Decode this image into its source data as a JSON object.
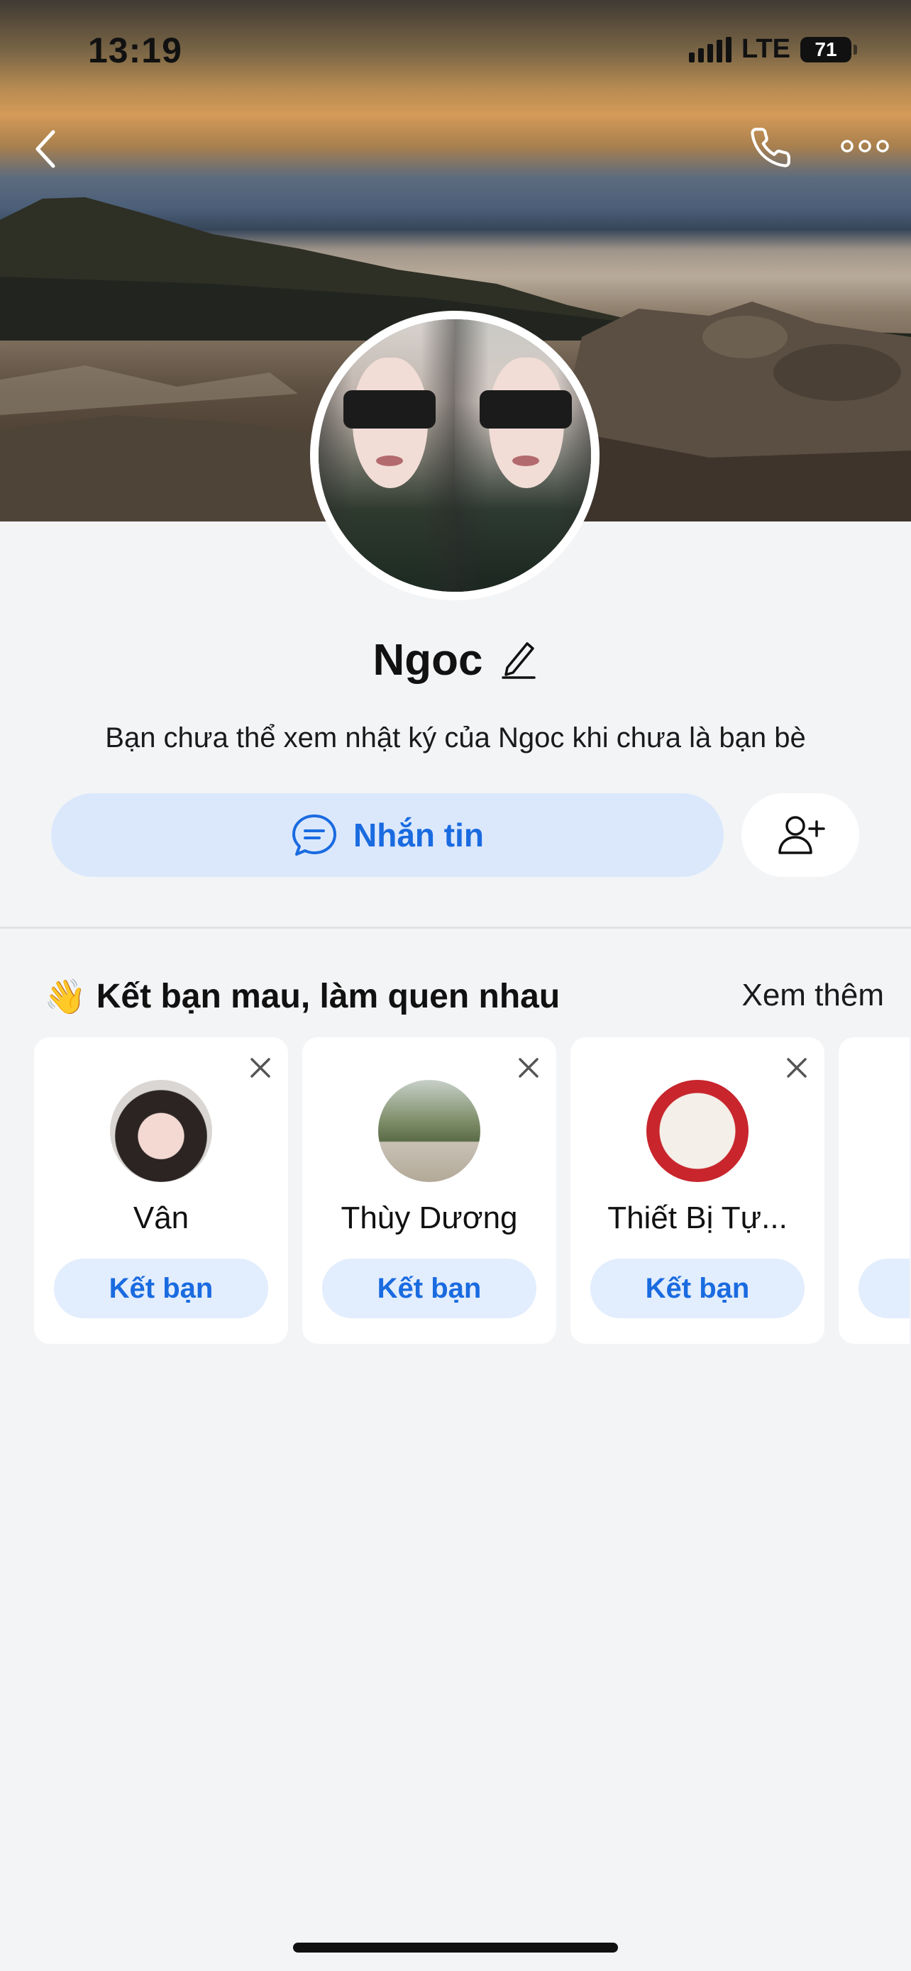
{
  "status_bar": {
    "time": "13:19",
    "network": "LTE",
    "battery": "71"
  },
  "header": {
    "back_icon": "chevron-left-icon",
    "call_icon": "phone-icon",
    "more_icon": "more-horizontal-icon"
  },
  "profile": {
    "name": "Ngoc",
    "edit_icon": "pencil-icon",
    "notice": "Bạn chưa thể xem nhật ký của Ngoc khi chưa là bạn bè",
    "message_label": "Nhắn tin",
    "message_icon": "chat-bubble-icon",
    "add_friend_icon": "user-plus-icon"
  },
  "suggestions": {
    "emoji": "👋",
    "title": "Kết bạn mau, làm quen nhau",
    "see_more": "Xem thêm",
    "items": [
      {
        "name": "Vân",
        "button": "Kết bạn"
      },
      {
        "name": "Thùy Dương",
        "button": "Kết bạn"
      },
      {
        "name": "Thiết Bị Tự...",
        "button": "Kết bạn"
      }
    ]
  },
  "colors": {
    "accent": "#1a6be0",
    "button_bg": "#dbe8fc",
    "page_bg": "#f3f4f6"
  }
}
